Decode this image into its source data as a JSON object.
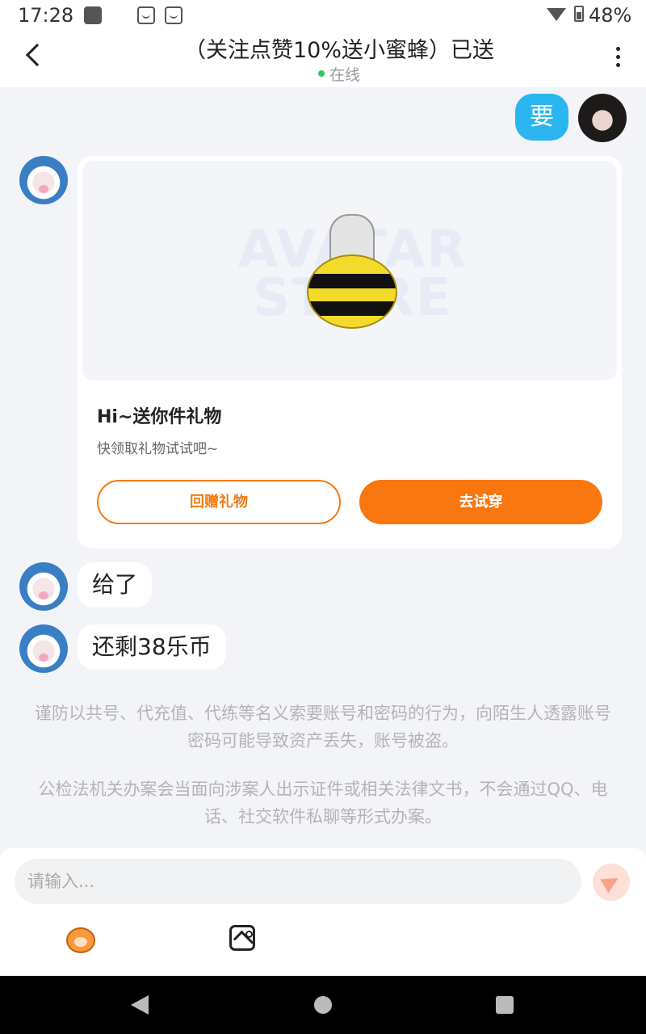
{
  "status_bar": {
    "time": "17:28",
    "battery": "48%"
  },
  "header": {
    "title": "（关注点赞10%送小蜜蜂）已送",
    "status": "在线"
  },
  "messages": {
    "outgoing_1": "要",
    "gift_card": {
      "watermark": "AVATAR STORE",
      "title": "Hi~送你件礼物",
      "subtitle": "快领取礼物试试吧~",
      "return_button": "回赠礼物",
      "try_button": "去试穿"
    },
    "incoming_1": "给了",
    "incoming_2": "还剩38乐币"
  },
  "notices": [
    "谨防以共号、代充值、代练等名义索要账号和密码的行为，向陌生人透露账号密码可能导致资产丢失，账号被盗。",
    "公检法机关办案会当面向涉案人出示证件或相关法律文书，不会通过QQ、电话、社交软件私聊等形式办案。"
  ],
  "input": {
    "placeholder": "请输入..."
  },
  "icons": {
    "back": "back-arrow-icon",
    "more": "more-vertical-icon",
    "send": "send-icon",
    "sticker": "sticker-icon",
    "image": "image-icon"
  },
  "colors": {
    "accent": "#f87710",
    "bubble_out": "#2bb6f0",
    "online": "#35c759"
  }
}
